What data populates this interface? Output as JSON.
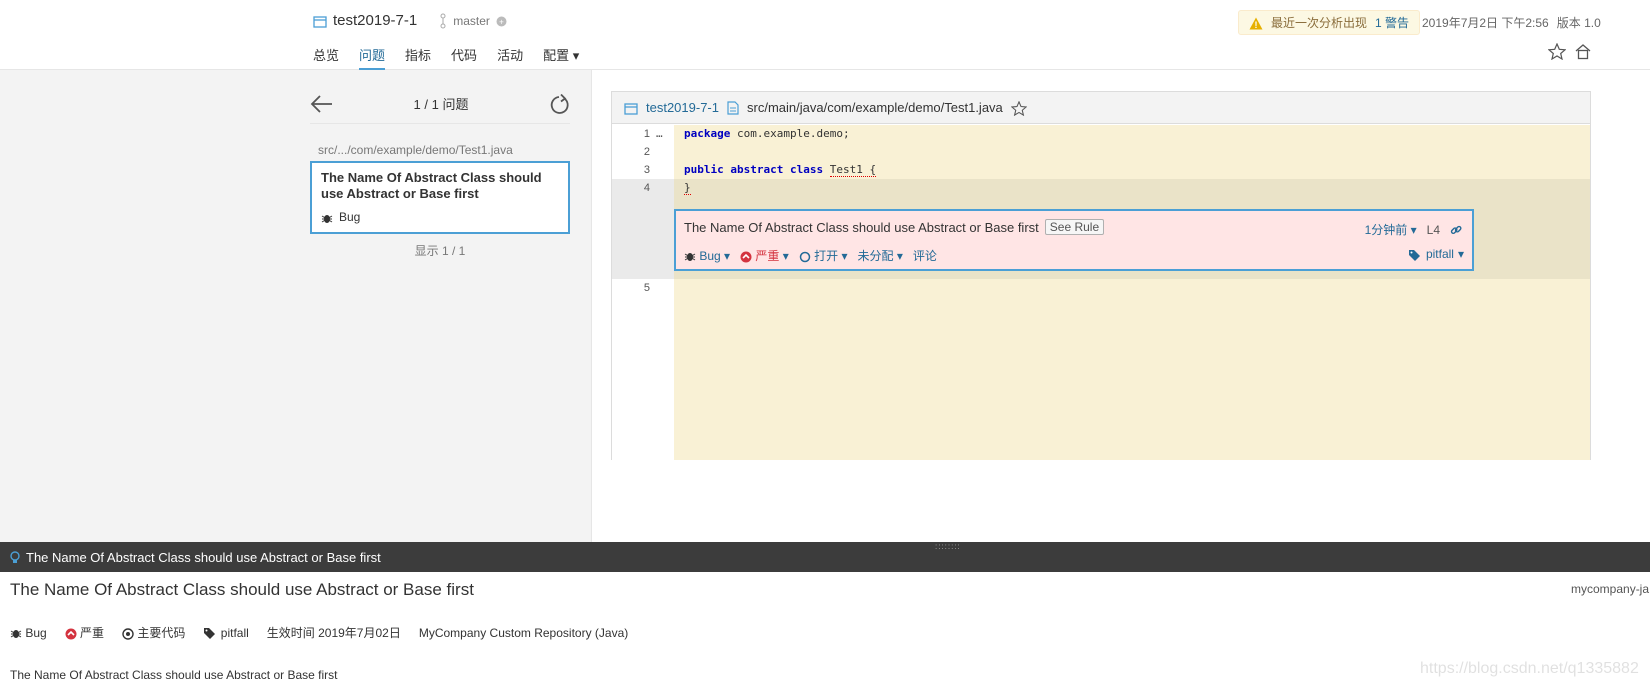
{
  "header": {
    "project": "test2019-7-1",
    "branch": "master",
    "nav": [
      "总览",
      "问题",
      "指标",
      "代码",
      "活动",
      "配置"
    ],
    "warning": {
      "text": "最近一次分析出现",
      "link": "1 警告"
    },
    "date": "2019年7月2日 下午2:56",
    "version": "版本 1.0"
  },
  "left": {
    "counter": "1 / 1 问题",
    "path": "src/.../com/example/demo/Test1.java",
    "issue_title": "The Name Of Abstract Class should use Abstract or Base first",
    "issue_type": "Bug",
    "footer": "显示 1 / 1"
  },
  "viewer": {
    "project": "test2019-7-1",
    "file": "src/main/java/com/example/demo/Test1.java",
    "lines": [
      {
        "num": "1",
        "text": "package com.example.demo;"
      },
      {
        "num": "2",
        "text": ""
      },
      {
        "num": "3",
        "text": "public abstract class Test1 {"
      },
      {
        "num": "4",
        "text": "}"
      },
      {
        "num": "5",
        "text": ""
      }
    ],
    "issue": {
      "message": "The Name Of Abstract Class should use Abstract or Base first",
      "see_rule": "See Rule",
      "time": "1分钟前",
      "line": "L4",
      "type": "Bug",
      "severity": "严重",
      "status": "打开",
      "assignee": "未分配",
      "comment": "评论",
      "tag": "pitfall"
    }
  },
  "bottom": {
    "bar_title": "The Name Of Abstract Class should use Abstract or Base first",
    "title": "The Name Of Abstract Class should use Abstract or Base first",
    "repo": "mycompany-ja",
    "type": "Bug",
    "severity": "严重",
    "scope": "主要代码",
    "tag": "pitfall",
    "effective": "生效时间 2019年7月02日",
    "repository": "MyCompany Custom Repository (Java)",
    "description": "The Name Of Abstract Class should use Abstract or Base first",
    "watermark": "https://blog.csdn.net/q1335882"
  }
}
